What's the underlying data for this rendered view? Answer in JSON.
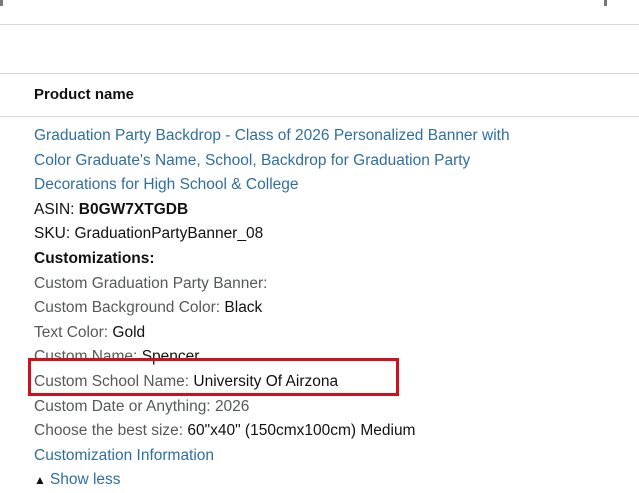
{
  "header": {
    "product_name_label": "Product name"
  },
  "product": {
    "title_line1": "Graduation Party Backdrop - Class of 2026 Personalized Banner with",
    "title_line2": "Color Graduate's Name, School, Backdrop for Graduation Party",
    "title_line3": "Decorations for High School & College",
    "asin_label": "ASIN:",
    "asin_value": "B0GW7XTGDB",
    "sku_label": "SKU:",
    "sku_value": "GraduationPartyBanner_08"
  },
  "customizations": {
    "heading": "Customizations:",
    "items": [
      {
        "label": "Custom Graduation Party Banner:",
        "value": ""
      },
      {
        "label": "Custom Background Color:",
        "value": "Black"
      },
      {
        "label": "Text Color:",
        "value": "Gold"
      },
      {
        "label": "Custom Name:",
        "value": "Spencer"
      },
      {
        "label": "Custom School Name:",
        "value": "University Of Airzona"
      },
      {
        "label": "Custom Date or Anything:",
        "value": "2026"
      },
      {
        "label": "Choose the best size:",
        "value": "60\"x40\" (150cmx100cm) Medium"
      }
    ],
    "info_link": "Customization Information",
    "show_less": "Show less"
  },
  "colors": {
    "link": "#2f6fa0",
    "highlight_box": "#d0111b"
  },
  "icons": {
    "show_less_caret": "caret-up-icon"
  }
}
